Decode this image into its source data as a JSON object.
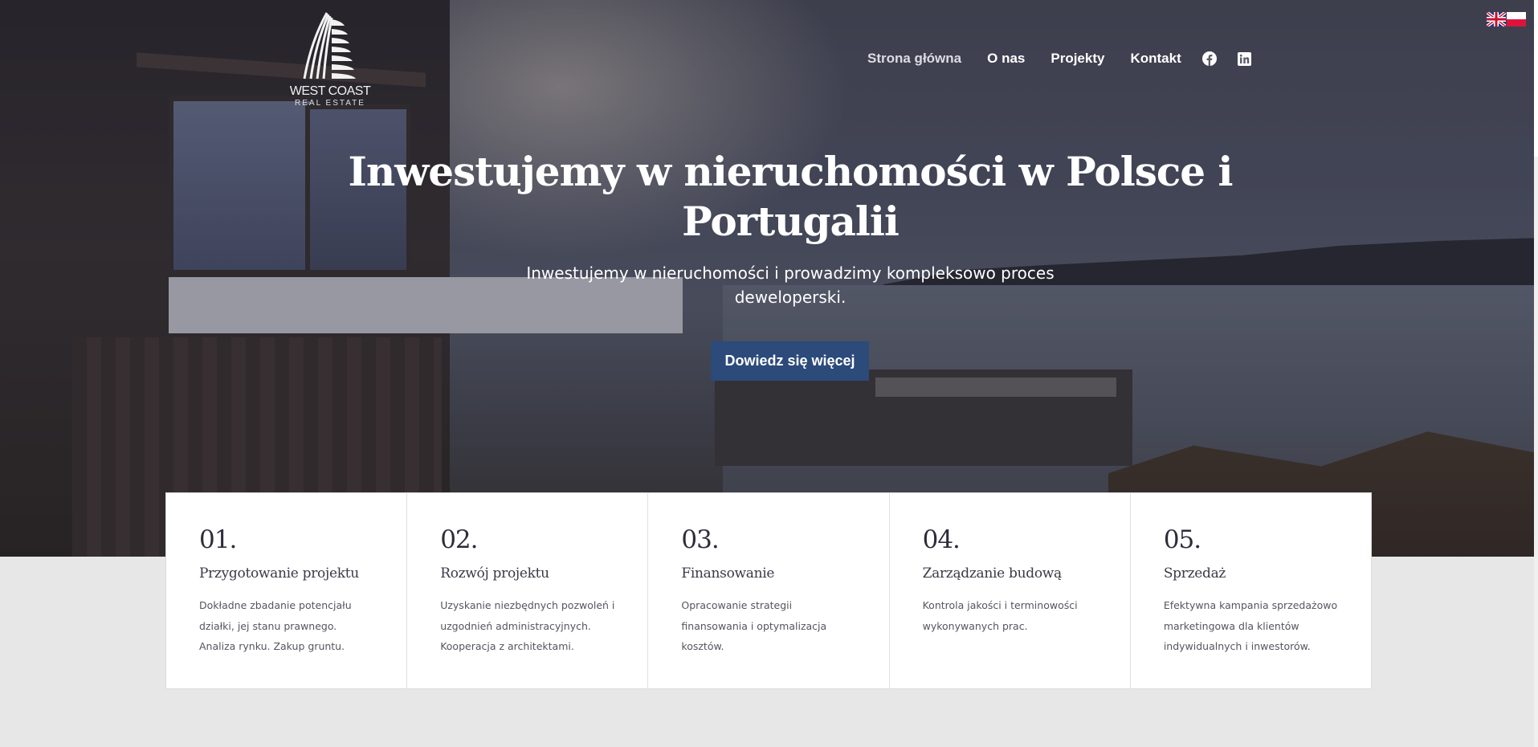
{
  "brand": {
    "name_line1": "WEST COAST",
    "name_line2": "REAL ESTATE"
  },
  "nav": {
    "items": [
      {
        "label": "Strona główna"
      },
      {
        "label": "O nas"
      },
      {
        "label": "Projekty"
      },
      {
        "label": "Kontakt"
      }
    ],
    "social": [
      "facebook-icon",
      "linkedin-icon"
    ]
  },
  "languages": [
    "English",
    "Polski"
  ],
  "hero": {
    "title": "Inwestujemy w nieruchomości w Polsce i Portugalii",
    "subtitle": "Inwestujemy w nieruchomości i prowadzimy kompleksowo proces deweloperski.",
    "cta_label": "Dowiedz się więcej"
  },
  "steps": [
    {
      "num": "01.",
      "title": "Przygotowanie projektu",
      "desc": "Dokładne zbadanie potencjału działki, jej stanu prawnego. Analiza rynku. Zakup gruntu."
    },
    {
      "num": "02.",
      "title": "Rozwój projektu",
      "desc": "Uzyskanie niezbędnych pozwoleń i uzgodnień administracyjnych. Kooperacja z architektami."
    },
    {
      "num": "03.",
      "title": "Finansowanie",
      "desc": "Opracowanie strategii finansowania i optymalizacja kosztów."
    },
    {
      "num": "04.",
      "title": "Zarządzanie budową",
      "desc": "Kontrola jakości i terminowości wykonywanych prac."
    },
    {
      "num": "05.",
      "title": "Sprzedaż",
      "desc": "Efektywna kampania sprzedażowo marketingowa dla klientów indywidualnych i inwestorów."
    }
  ],
  "colors": {
    "accent": "#2c4a7a",
    "page_bg": "#e7e7e7",
    "card_bg": "#ffffff"
  }
}
